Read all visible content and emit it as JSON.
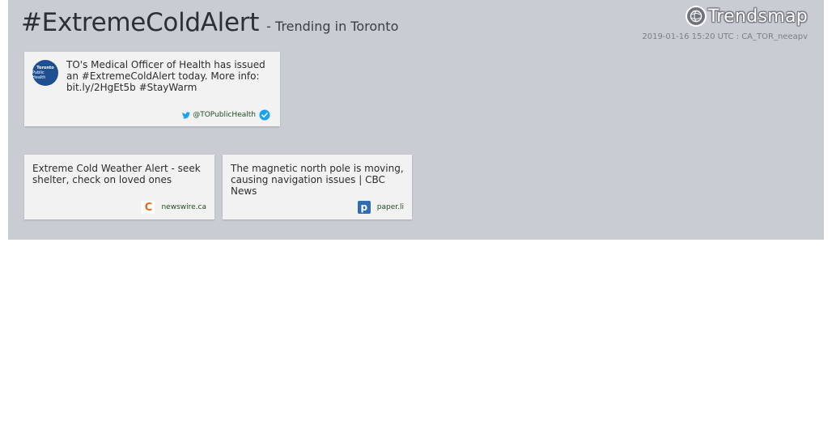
{
  "header": {
    "hashtag": "#ExtremeColdAlert",
    "subtitle": "- Trending in Toronto",
    "logo_text": "Trendsmap",
    "meta": "2019-01-16 15:20 UTC : CA_TOR_neeapv"
  },
  "tweet": {
    "text": "TO's Medical Officer of Health has issued an #ExtremeColdAlert today. More info: bit.ly/2HgEt5b #StayWarm",
    "handle": "@TOPublicHealth",
    "avatar_line1": "Toronto",
    "avatar_line2": "Public Health",
    "icon": "twitter-bird-icon",
    "verified_icon": "verified-badge-icon"
  },
  "links": [
    {
      "title": "Extreme Cold Weather Alert - seek shelter, check on loved ones",
      "source": "newswire.ca",
      "icon": "newswire-icon",
      "icon_glyph": "C"
    },
    {
      "title": "The magnetic north pole is moving, causing navigation issues | CBC News",
      "source": "paper.li",
      "icon": "paperli-icon",
      "icon_glyph": "p"
    }
  ],
  "colors": {
    "panel": "#c9ccd3",
    "card": "#f2f2f2",
    "twitter_blue": "#1da1f2",
    "source_text": "#1f4e1f"
  }
}
